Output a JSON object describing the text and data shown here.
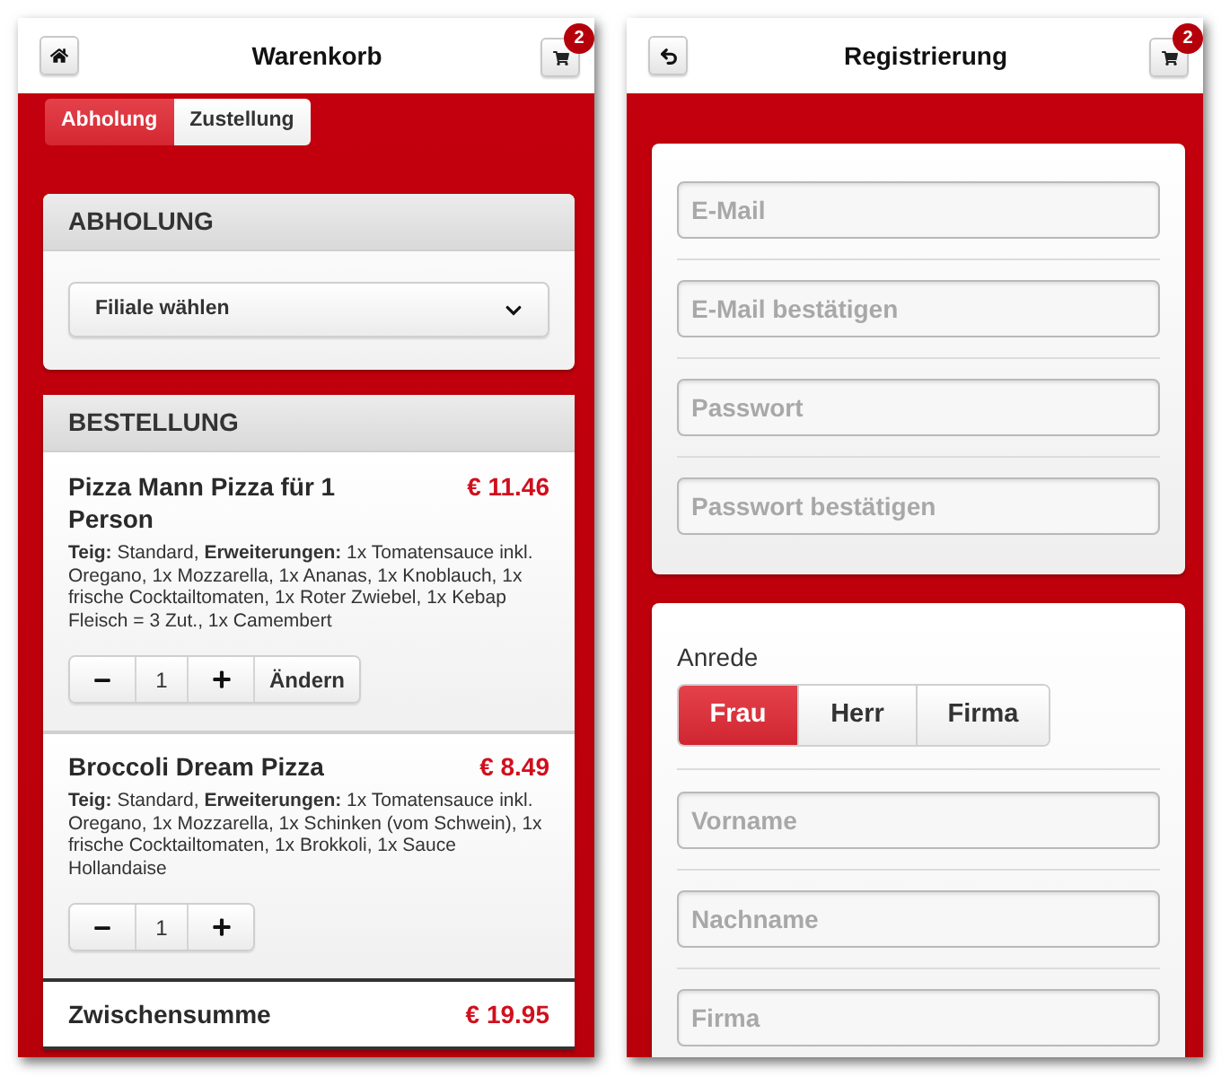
{
  "cart_screen": {
    "header": {
      "nav_button": {
        "kind": "home"
      },
      "title": "Warenkorb",
      "cart_badge": "2"
    },
    "tabs": [
      {
        "label": "Abholung",
        "selected": true
      },
      {
        "label": "Zustellung",
        "selected": false
      }
    ],
    "pickup_card": {
      "title": "ABHOLUNG",
      "branch_select": {
        "value": "Filiale wählen"
      }
    },
    "order_card": {
      "title": "BESTELLUNG",
      "items": [
        {
          "name": "Pizza Mann Pizza für 1 Person",
          "price": "€ 11.46",
          "details": "**Teig:** Standard, **Erweiterungen:** 1x Tomatensauce inkl. Oregano, 1x Mozzarella, 1x Ananas, 1x Knoblauch, 1x frische Cocktailtomaten, 1x Roter Zwiebel, 1x Kebap Fleisch = 3 Zut., 1x Camembert",
          "quantity": "1",
          "edit_label": "Ändern"
        },
        {
          "name": "Broccoli Dream Pizza",
          "price": "€ 8.49",
          "details": "**Teig:** Standard, **Erweiterungen:** 1x Tomatensauce inkl. Oregano, 1x Mozzarella, 1x Schinken (vom Schwein), 1x frische Cocktailtomaten, 1x Brokkoli, 1x Sauce Hollandaise",
          "quantity": "1"
        }
      ],
      "subtotal": {
        "label": "Zwischensumme",
        "value": "€ 19.95"
      }
    }
  },
  "registration_screen": {
    "header": {
      "nav_button": {
        "kind": "back"
      },
      "title": "Registrierung",
      "cart_badge": "2"
    },
    "account_fields": [
      {
        "placeholder": "E-Mail"
      },
      {
        "placeholder": "E-Mail bestätigen"
      },
      {
        "placeholder": "Passwort"
      },
      {
        "placeholder": "Passwort bestätigen"
      }
    ],
    "salutation": {
      "label": "Anrede",
      "options": [
        {
          "label": "Frau",
          "selected": true
        },
        {
          "label": "Herr",
          "selected": false
        },
        {
          "label": "Firma",
          "selected": false
        }
      ]
    },
    "personal_fields": [
      {
        "placeholder": "Vorname"
      },
      {
        "placeholder": "Nachname"
      },
      {
        "placeholder": "Firma"
      }
    ]
  }
}
